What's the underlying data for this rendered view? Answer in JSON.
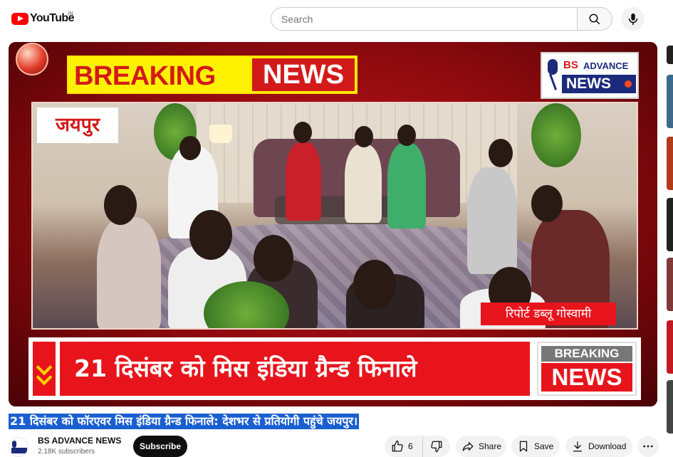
{
  "header": {
    "logo_text": "YouTube",
    "country_code": "IN",
    "search_placeholder": "Search",
    "search_icon": "search-icon",
    "mic_icon": "mic-icon"
  },
  "video": {
    "overlay": {
      "breaking_left": "BREAKING",
      "breaking_right": "NEWS",
      "brand_bs": "BS",
      "brand_advance": "ADVANCE",
      "brand_news": "NEWS",
      "city": "जयपुर",
      "reporter": "रिपोर्ट डब्लू गोस्वामी",
      "ticker_text": "21 दिसंबर को मिस इंडिया ग्रैन्ड फिनाले",
      "ticker_badge_top": "BREAKING",
      "ticker_badge_bottom": "NEWS"
    }
  },
  "title": "21 दिसंबर को फॉरएवर मिस इंडिया ग्रैन्ड फिनाले: देशभर से प्रतियोगी पहुंचे जयपुर।",
  "channel": {
    "name": "BS ADVANCE NEWS",
    "subscribers": "2.18K subscribers",
    "subscribe_label": "Subscribe"
  },
  "actions": {
    "like_count": "6",
    "share_label": "Share",
    "save_label": "Save",
    "download_label": "Download",
    "more_icon": "more-horizontal-icon"
  },
  "colors": {
    "youtube_red": "#ff0000",
    "news_red": "#e8141c",
    "breaking_yellow": "#fff200",
    "brand_navy": "#1b2a7a",
    "title_highlight": "#1a5fd0"
  }
}
